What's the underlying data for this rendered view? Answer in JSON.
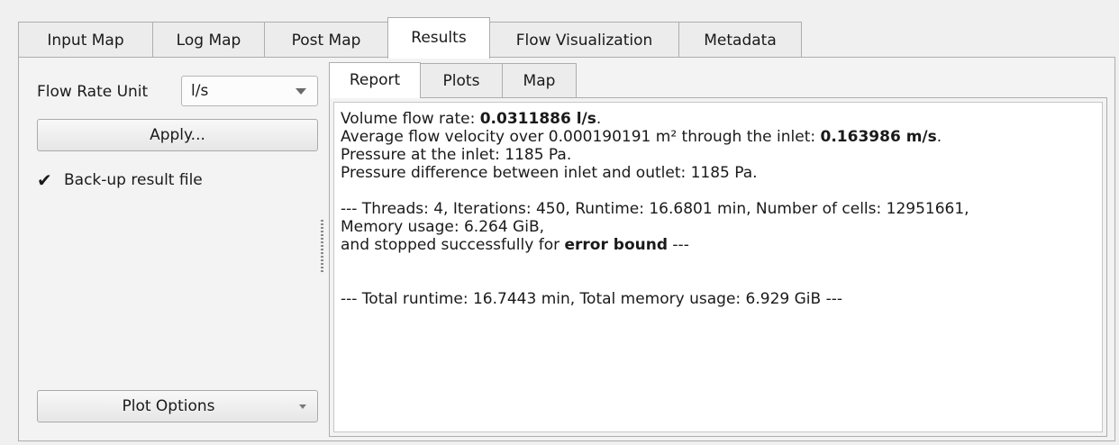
{
  "top_tabs": [
    "Input Map",
    "Log Map",
    "Post Map",
    "Results",
    "Flow Visualization",
    "Metadata"
  ],
  "active_top_tab": "Results",
  "left_panel": {
    "flow_rate_label": "Flow Rate Unit",
    "flow_rate_unit": "l/s",
    "apply_label": "Apply...",
    "backup_checkbox_label": "Back-up result file",
    "backup_checked": true,
    "plot_options_label": "Plot Options"
  },
  "inner_tabs": [
    "Report",
    "Plots",
    "Map"
  ],
  "active_inner_tab": "Report",
  "report": {
    "line1_prefix": "Volume flow rate: ",
    "line1_value": "0.0311886 l/s",
    "line1_suffix": ".",
    "line2_prefix": "Average flow velocity over 0.000190191 m² through the inlet: ",
    "line2_value": "0.163986 m/s",
    "line2_suffix": ".",
    "line3": "Pressure at the inlet: 1185 Pa.",
    "line4": "Pressure difference between inlet and outlet: 1185 Pa.",
    "line5": "--- Threads: 4, Iterations: 450, Runtime: 16.6801 min, Number of cells: 12951661,",
    "line6": "Memory usage: 6.264 GiB,",
    "line7_prefix": "and stopped successfully for ",
    "line7_bold": "error bound",
    "line7_suffix": " ---",
    "line8": "--- Total runtime: 16.7443 min, Total memory usage: 6.929 GiB ---"
  }
}
